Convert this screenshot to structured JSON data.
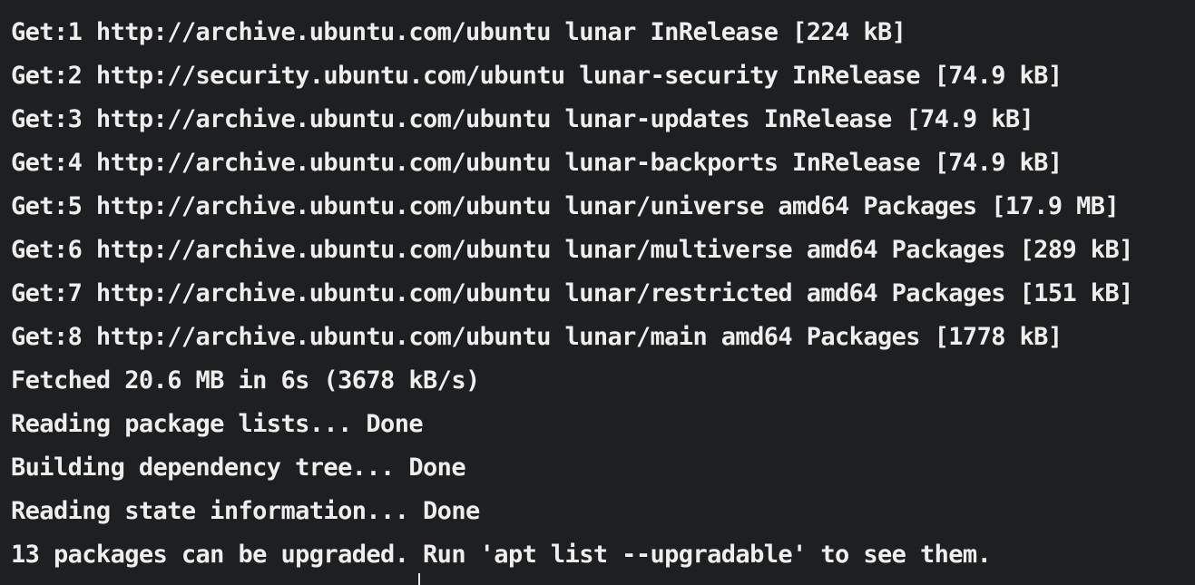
{
  "terminal": {
    "lines": [
      "Get:1 http://archive.ubuntu.com/ubuntu lunar InRelease [224 kB]",
      "Get:2 http://security.ubuntu.com/ubuntu lunar-security InRelease [74.9 kB]",
      "Get:3 http://archive.ubuntu.com/ubuntu lunar-updates InRelease [74.9 kB]",
      "Get:4 http://archive.ubuntu.com/ubuntu lunar-backports InRelease [74.9 kB]",
      "Get:5 http://archive.ubuntu.com/ubuntu lunar/universe amd64 Packages [17.9 MB]",
      "Get:6 http://archive.ubuntu.com/ubuntu lunar/multiverse amd64 Packages [289 kB]",
      "Get:7 http://archive.ubuntu.com/ubuntu lunar/restricted amd64 Packages [151 kB]",
      "Get:8 http://archive.ubuntu.com/ubuntu lunar/main amd64 Packages [1778 kB]",
      "Fetched 20.6 MB in 6s (3678 kB/s)",
      "Reading package lists... Done",
      "Building dependency tree... Done",
      "Reading state information... Done",
      "13 packages can be upgraded. Run 'apt list --upgradable' to see them."
    ],
    "colors": {
      "background": "#1e1f20",
      "foreground": "#eeeeee"
    }
  }
}
